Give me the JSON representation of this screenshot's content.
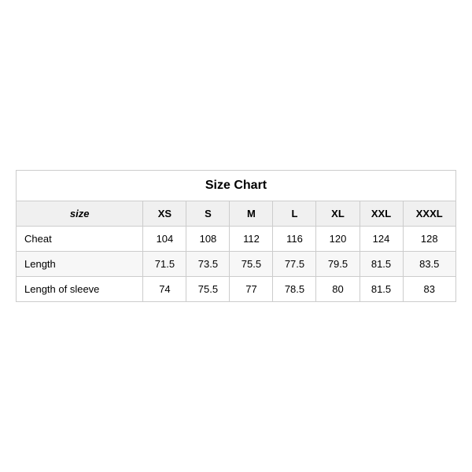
{
  "table": {
    "title": "Size Chart",
    "headers": [
      "size",
      "XS",
      "S",
      "M",
      "L",
      "XL",
      "XXL",
      "XXXL"
    ],
    "rows": [
      {
        "label": "Cheat",
        "values": [
          "104",
          "108",
          "112",
          "116",
          "120",
          "124",
          "128"
        ]
      },
      {
        "label": "Length",
        "values": [
          "71.5",
          "73.5",
          "75.5",
          "77.5",
          "79.5",
          "81.5",
          "83.5"
        ]
      },
      {
        "label": "Length of sleeve",
        "values": [
          "74",
          "75.5",
          "77",
          "78.5",
          "80",
          "81.5",
          "83"
        ]
      }
    ]
  }
}
